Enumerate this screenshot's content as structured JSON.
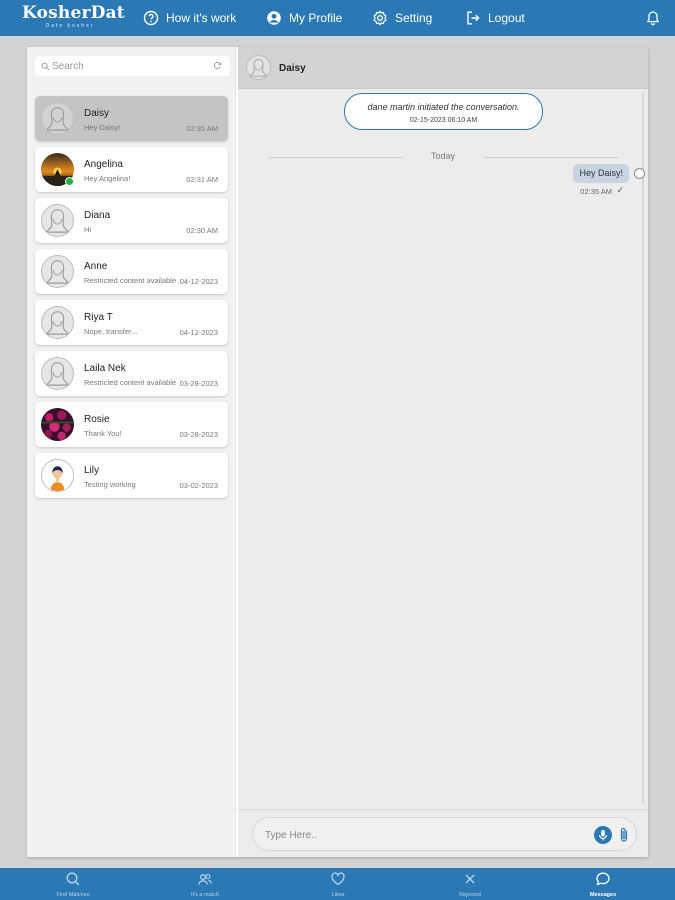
{
  "header": {
    "brand": "KosherDat",
    "tagline": "Date kosher",
    "nav": [
      {
        "label": "How it's work",
        "icon": "question-circle-icon"
      },
      {
        "label": "My Profile",
        "icon": "user-circle-icon"
      },
      {
        "label": "Setting",
        "icon": "gear-icon"
      },
      {
        "label": "Logout",
        "icon": "logout-icon"
      }
    ],
    "notification_icon": "bell-icon"
  },
  "sidebar": {
    "search_placeholder": "Search",
    "conversations": [
      {
        "name": "Daisy",
        "preview": "Hey Daisy!",
        "time": "02:35 AM",
        "active": true,
        "avatar": "placeholder"
      },
      {
        "name": "Angelina",
        "preview": "Hey Angelina!",
        "time": "02:31 AM",
        "online": true,
        "avatar": "sunset-photo"
      },
      {
        "name": "Diana",
        "preview": "Hi",
        "time": "02:30 AM",
        "avatar": "placeholder"
      },
      {
        "name": "Anne",
        "preview": "Restricted content available",
        "time": "04-12-2023",
        "avatar": "placeholder"
      },
      {
        "name": "Riya T",
        "preview": "Nope, transfer...",
        "time": "04-12-2023",
        "avatar": "placeholder"
      },
      {
        "name": "Laila Nek",
        "preview": "Restricted content available",
        "time": "03-28-2023",
        "avatar": "placeholder"
      },
      {
        "name": "Rosie",
        "preview": "Thank You!",
        "time": "03-28-2023",
        "avatar": "flowers-photo"
      },
      {
        "name": "Lily",
        "preview": "Testing working",
        "time": "03-02-2023",
        "avatar": "woman-illustration"
      }
    ]
  },
  "chat": {
    "contact_name": "Daisy",
    "system_message": "dane martin initiated the conversation.",
    "system_time": "02-15-2023 06:10 AM",
    "day_divider": "Today",
    "messages": [
      {
        "text": "Hey Daisy!",
        "time": "02:35 AM",
        "status": "✓",
        "outgoing": true
      }
    ],
    "composer_placeholder": "Type Here..",
    "mic_icon": "microphone-icon",
    "attach_icon": "paperclip-icon"
  },
  "bottom_nav": [
    {
      "label": "Find Matches",
      "icon": "search-icon"
    },
    {
      "label": "It's a match",
      "icon": "users-icon"
    },
    {
      "label": "Likes",
      "icon": "heart-icon"
    },
    {
      "label": "Rejected",
      "icon": "x-icon"
    },
    {
      "label": "Messages",
      "icon": "chat-bubble-icon",
      "active": true
    }
  ],
  "colors": {
    "brand_blue": "#2b79b4",
    "active_conversation": "#c4c4c4",
    "online_green": "#24b539",
    "outgoing_bubble": "#c7d5e3"
  }
}
